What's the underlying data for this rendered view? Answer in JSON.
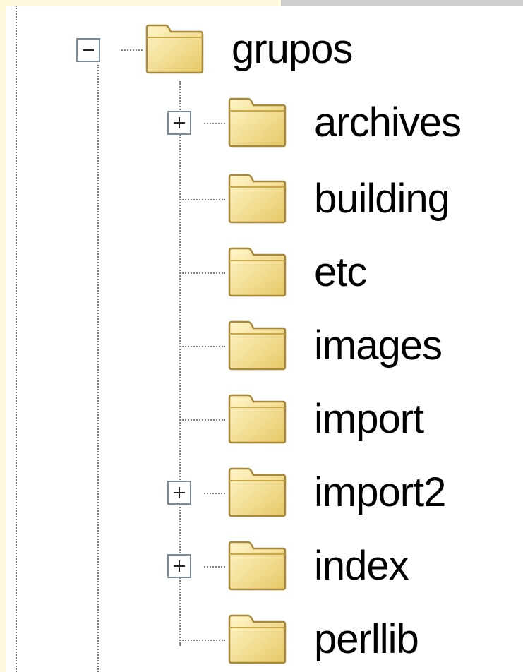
{
  "tree": {
    "root": {
      "label": "grupos",
      "expander": "minus",
      "icon": "folder-icon"
    },
    "children": [
      {
        "label": "archives",
        "expander": "plus",
        "icon": "folder-icon"
      },
      {
        "label": "building",
        "expander": "none",
        "icon": "folder-icon"
      },
      {
        "label": "etc",
        "expander": "none",
        "icon": "folder-icon"
      },
      {
        "label": "images",
        "expander": "none",
        "icon": "folder-icon"
      },
      {
        "label": "import",
        "expander": "none",
        "icon": "folder-icon"
      },
      {
        "label": "import2",
        "expander": "plus",
        "icon": "folder-icon"
      },
      {
        "label": "index",
        "expander": "plus",
        "icon": "folder-icon"
      },
      {
        "label": "perllib",
        "expander": "none",
        "icon": "folder-icon"
      }
    ]
  },
  "colors": {
    "folder_fill": "#f5e08f",
    "folder_stroke": "#b8963a",
    "tree_line": "#7f7f7f",
    "expander_border": "#7d8c99",
    "panel_strip": "#fff9dc"
  }
}
